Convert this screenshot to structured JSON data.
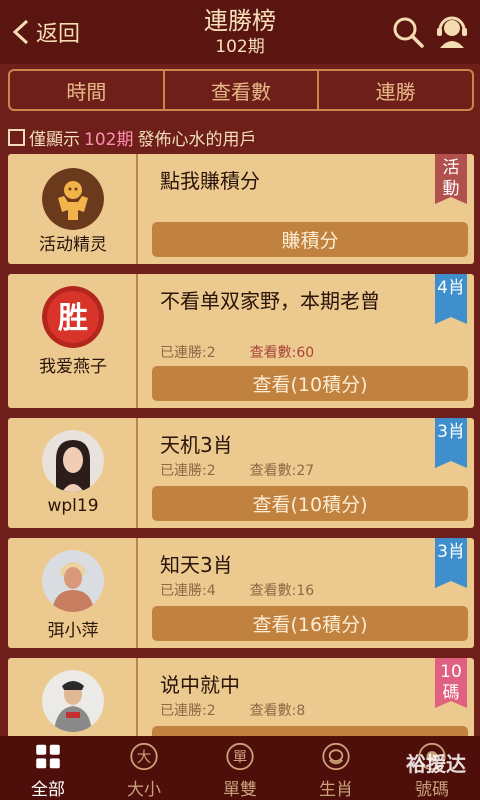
{
  "header": {
    "back_label": "返回",
    "title": "連勝榜",
    "subtitle": "102期"
  },
  "tabs": [
    {
      "label": "時間"
    },
    {
      "label": "查看數"
    },
    {
      "label": "連勝"
    }
  ],
  "filter": {
    "prefix": "僅顯示",
    "highlight": "102期",
    "suffix": "發佈心水的用戶"
  },
  "cards": [
    {
      "username": "活动精灵",
      "title": "點我賺積分",
      "button": "賺積分",
      "badge": "活動",
      "badge_color": "#b0514d"
    },
    {
      "username": "我爱燕子",
      "title": "不看单双家野，本期老曾",
      "streak": "已連勝:2",
      "views": "查看數:60",
      "button": "查看(10積分)",
      "badge": "4肖",
      "badge_color": "#3f8fcc"
    },
    {
      "username": "wpl19",
      "title": "天机3肖",
      "streak": "已連勝:2",
      "views": "查看數:27",
      "button": "查看(10積分)",
      "badge": "3肖",
      "badge_color": "#3f8fcc"
    },
    {
      "username": "弭小萍",
      "title": "知天3肖",
      "streak": "已連勝:4",
      "views": "查看數:16",
      "button": "查看(16積分)",
      "badge": "3肖",
      "badge_color": "#3f8fcc"
    },
    {
      "username": "",
      "title": "说中就中",
      "streak": "已連勝:2",
      "views": "查看數:8",
      "badge": "10碼",
      "badge_color": "#e0607f"
    }
  ],
  "bottom_nav": [
    {
      "label": "全部",
      "icon": "grid-icon",
      "active": true
    },
    {
      "label": "大小",
      "icon": "da-icon",
      "glyph": "大"
    },
    {
      "label": "單雙",
      "icon": "dan-icon",
      "glyph": "單"
    },
    {
      "label": "生肖",
      "icon": "zodiac-icon"
    },
    {
      "label": "號碼",
      "icon": "number-icon"
    }
  ],
  "watermark": "裕援达",
  "avatar_glyph": "胜"
}
